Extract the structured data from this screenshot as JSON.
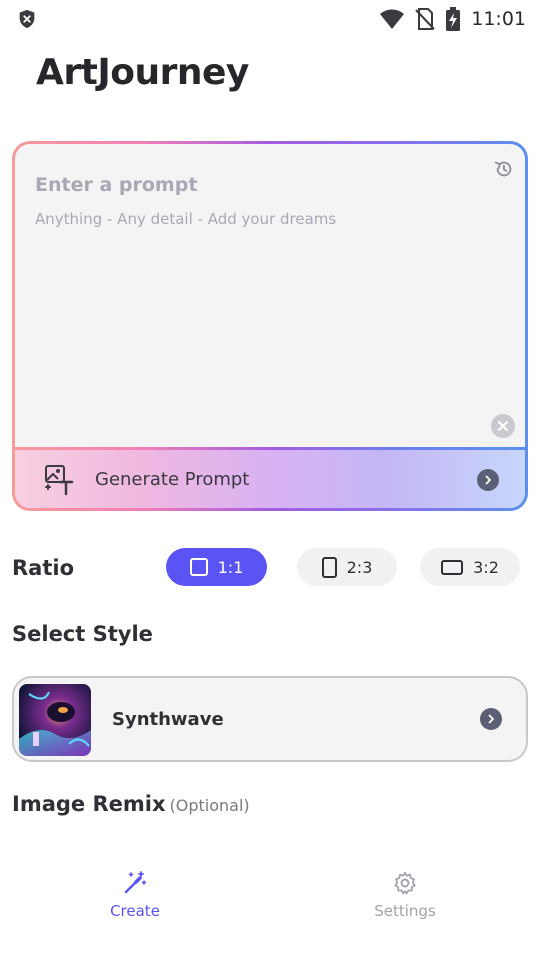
{
  "status_bar": {
    "time": "11:01",
    "icons": [
      "shield-x-icon",
      "wifi-icon",
      "no-sim-icon",
      "battery-charging-icon"
    ]
  },
  "app": {
    "title": "ArtJourney"
  },
  "prompt": {
    "placeholder_title": "Enter a prompt",
    "placeholder_sub": "Anything - Any detail - Add your dreams",
    "history_icon": "history-icon",
    "clear_icon": "clear-icon",
    "generate_label": "Generate Prompt",
    "generate_icon": "image-text-icon"
  },
  "ratio": {
    "label": "Ratio",
    "options": [
      {
        "label": "1:1",
        "selected": true
      },
      {
        "label": "2:3",
        "selected": false
      },
      {
        "label": "3:2",
        "selected": false
      }
    ]
  },
  "style": {
    "section_label": "Select Style",
    "selected_name": "Synthwave"
  },
  "remix": {
    "title": "Image Remix",
    "optional": "(Optional)"
  },
  "nav": {
    "create": "Create",
    "settings": "Settings"
  },
  "colors": {
    "accent": "#5b54f5",
    "inactive": "#a0a3ad",
    "card_bg": "#f4f4f5"
  }
}
